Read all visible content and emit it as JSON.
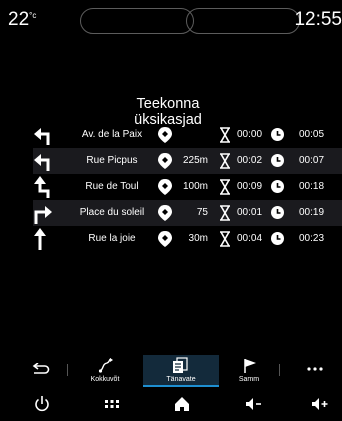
{
  "status": {
    "temperature": "22",
    "temp_unit": "°c",
    "time": "12:55"
  },
  "title_line1": "Teekonna",
  "title_line2": "üksikasjad",
  "routes": [
    {
      "direction_icon": "turn-left-arrow-icon",
      "street": "Av. de la Paix",
      "distance": "",
      "duration": "00:00",
      "eta": "00:05"
    },
    {
      "direction_icon": "turn-left-arrow-icon",
      "street": "Rue Picpus",
      "distance": "225m",
      "duration": "00:02",
      "eta": "00:07"
    },
    {
      "direction_icon": "keep-left-arrow-icon",
      "street": "Rue de Toul",
      "distance": "100m",
      "duration": "00:09",
      "eta": "00:18"
    },
    {
      "direction_icon": "turn-right-arrow-icon",
      "street": "Place du soleil",
      "distance": "75",
      "duration": "00:01",
      "eta": "00:19"
    },
    {
      "direction_icon": "straight-arrow-icon",
      "street": "Rue la joie",
      "distance": "30m",
      "duration": "00:04",
      "eta": "00:23"
    }
  ],
  "tabs": {
    "back_icon": "back-icon",
    "summary_label": "Kokkuvõt",
    "streets_label": "Tänavate",
    "steps_label": "Samm",
    "more_icon": "more-icon"
  },
  "bottom": [
    "power-icon",
    "apps-grid-icon",
    "home-icon",
    "volume-down-icon",
    "volume-up-icon"
  ],
  "colors": {
    "accent": "#1e8fd1",
    "row_alt": "#1a1a1e",
    "background": "#000000"
  }
}
